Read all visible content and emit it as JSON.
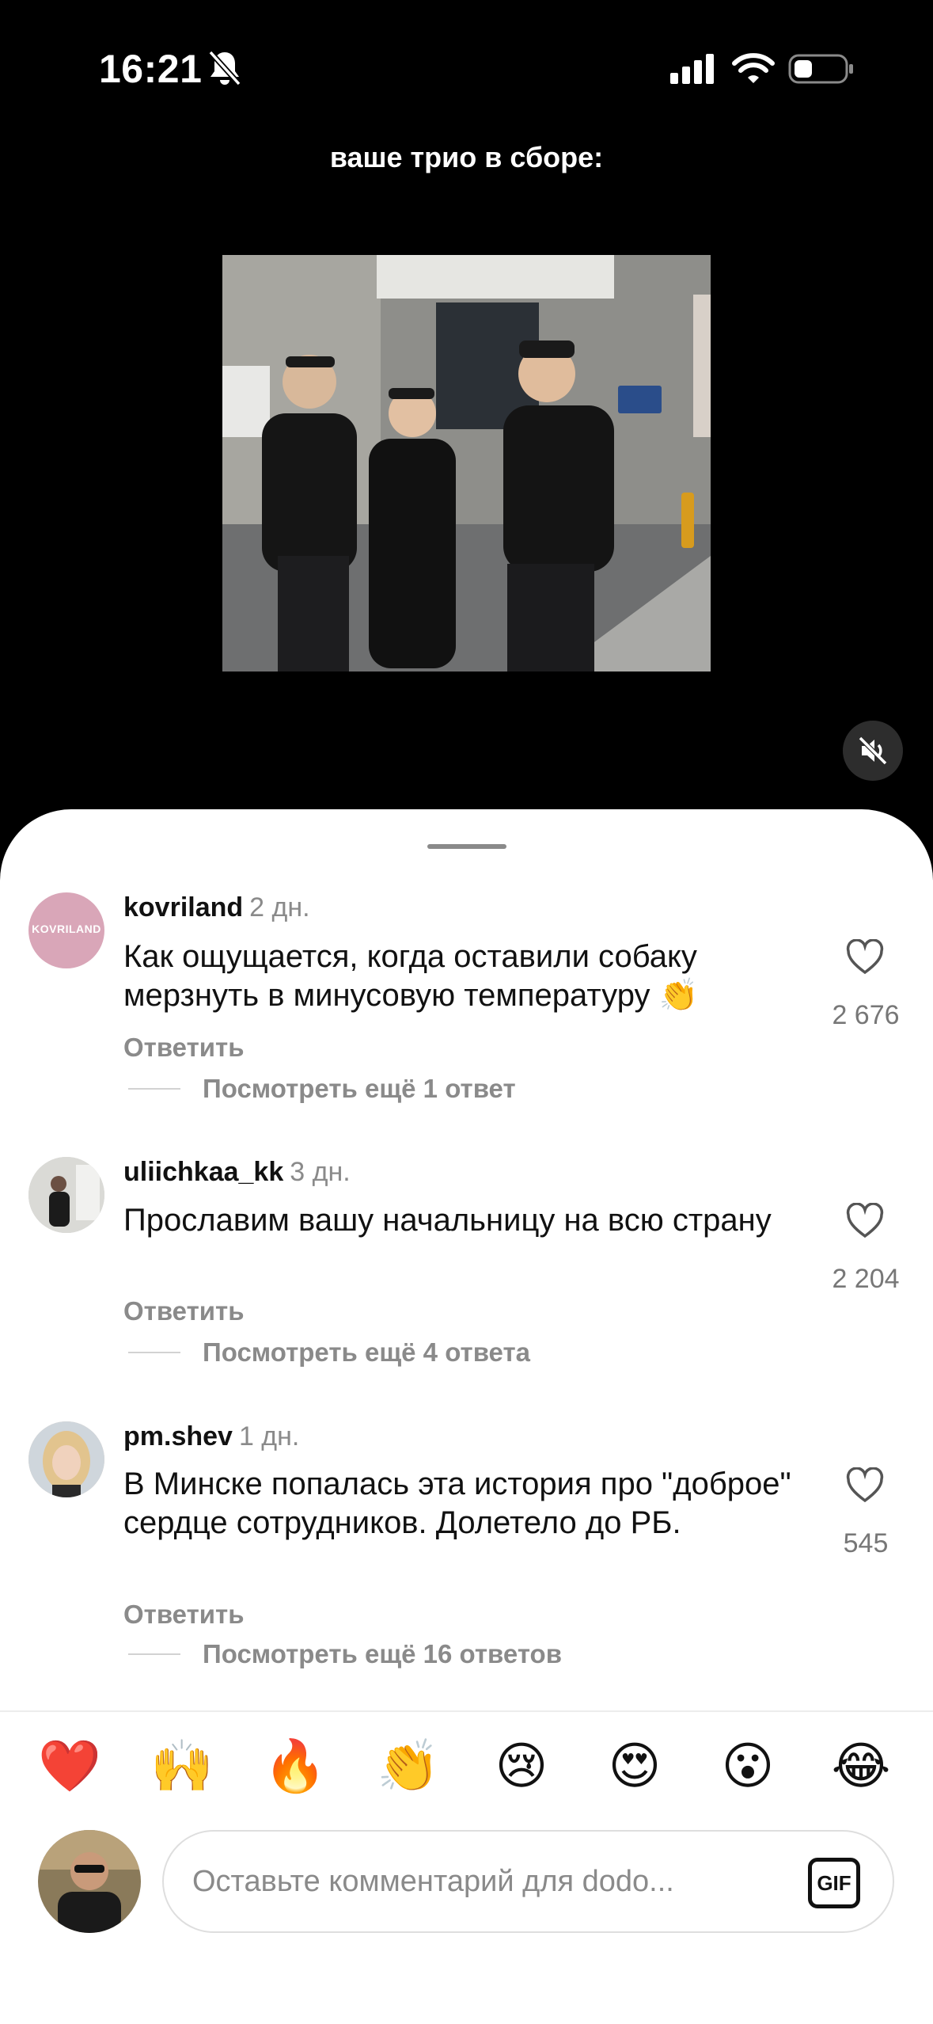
{
  "status_bar": {
    "time": "16:21",
    "icons": [
      "bell-slash-icon",
      "cellular-signal-icon",
      "wifi-icon",
      "battery-icon"
    ]
  },
  "video": {
    "caption": "ваше трио в сборе:",
    "mute_icon": "speaker-muted-icon"
  },
  "comments": [
    {
      "username": "kovriland",
      "time": "2 дн.",
      "avatar_label": "KOVRILAND",
      "text": "Как ощущается, когда оставили собаку мерзнуть в минусовую температуру 👏",
      "reply_label": "Ответить",
      "more_replies": "Посмотреть ещё 1 ответ",
      "likes": "2 676"
    },
    {
      "username": "uliichkaa_kk",
      "time": "3 дн.",
      "text": "Прославим вашу начальницу на всю страну",
      "reply_label": "Ответить",
      "more_replies": "Посмотреть ещё 4 ответа",
      "likes": "2 204"
    },
    {
      "username": "pm.shev",
      "time": "1 дн.",
      "text": "В Минске попалась эта история про \"доброе\" сердце сотрудников. Долетело до РБ.",
      "reply_label": "Ответить",
      "more_replies": "Посмотреть ещё 16 ответов",
      "likes": "545"
    }
  ],
  "quick_reactions": [
    "❤️",
    "🙌",
    "🔥",
    "👏",
    "😢",
    "😍",
    "😮",
    "😂"
  ],
  "composer": {
    "placeholder": "Оставьте комментарий для dodo...",
    "gif_label": "GIF"
  }
}
